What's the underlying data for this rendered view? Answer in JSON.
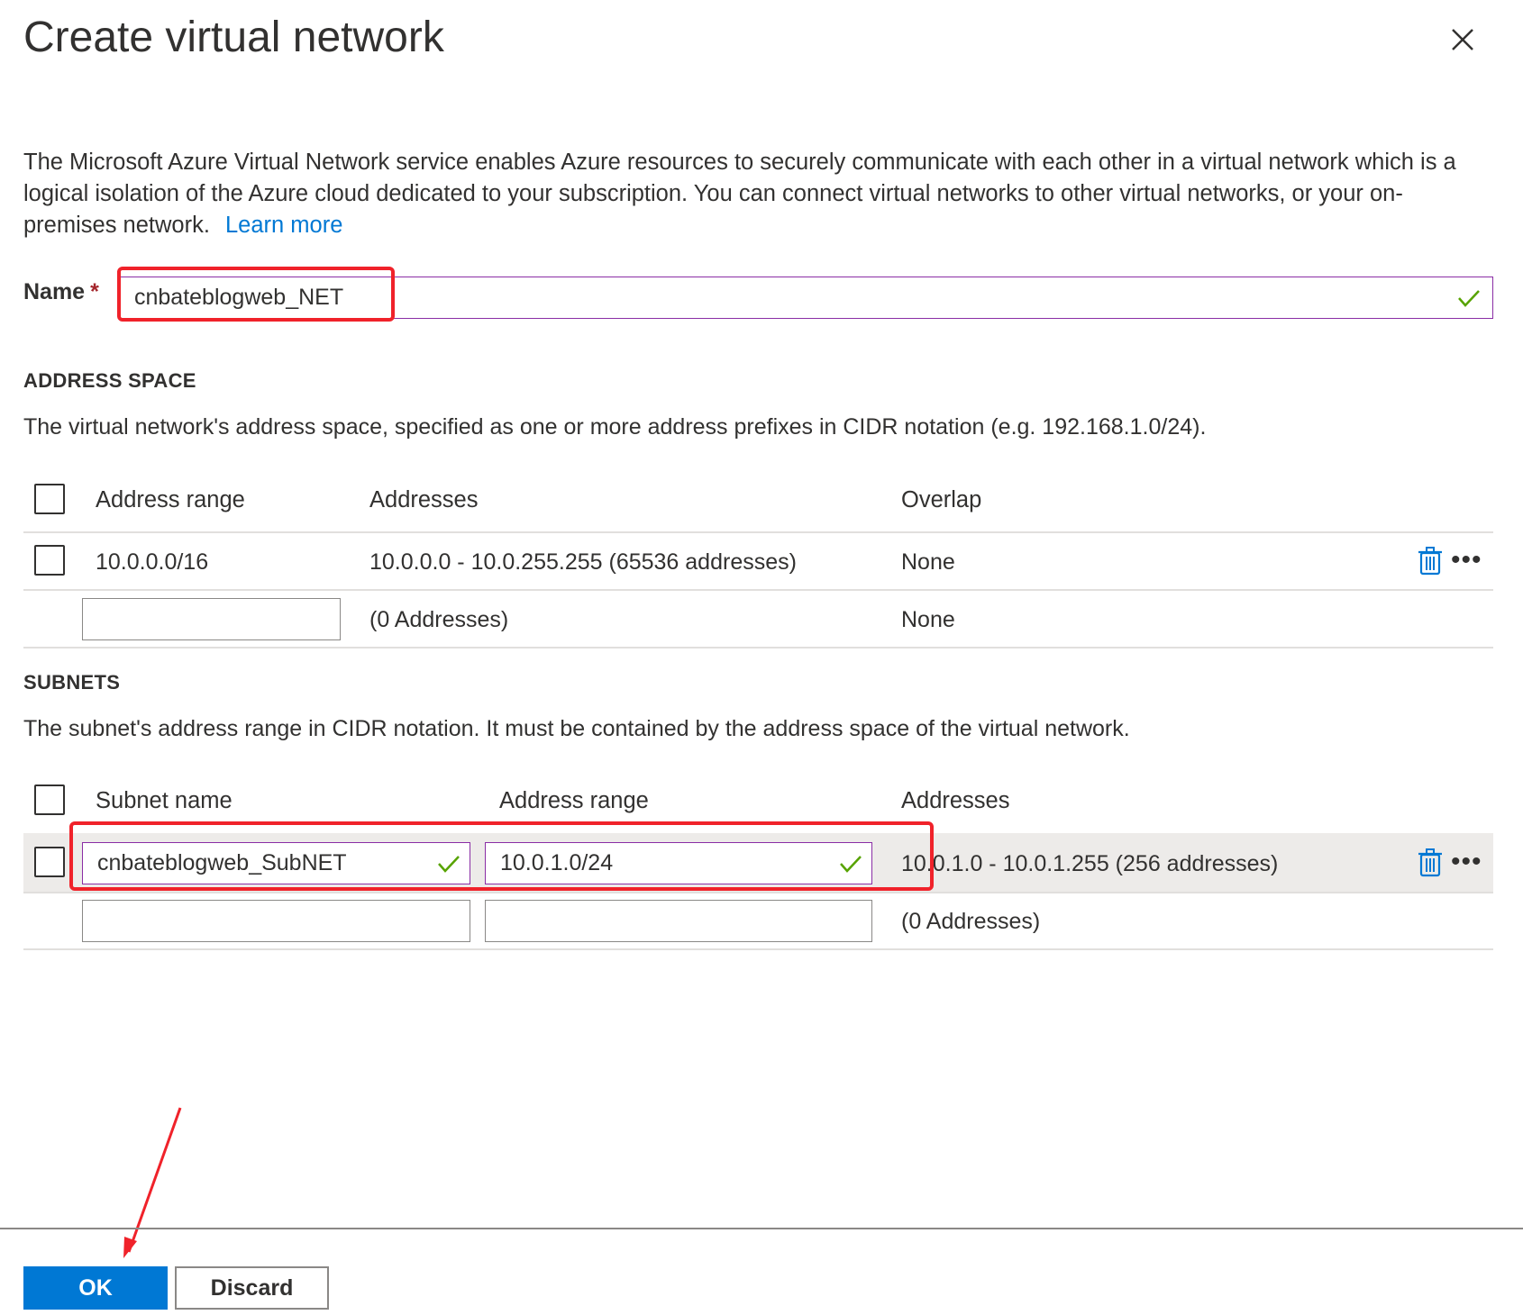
{
  "dialog": {
    "title": "Create virtual network",
    "description": "The Microsoft Azure Virtual Network service enables Azure resources to securely communicate with each other in a virtual network which is a logical isolation of the Azure cloud dedicated to your subscription. You can connect virtual networks to other virtual networks, or your on-premises network.",
    "learn_more": "Learn more",
    "close_icon": "close-icon"
  },
  "name_field": {
    "label": "Name",
    "required_marker": "*",
    "value": "cnbateblogweb_NET",
    "status": "valid"
  },
  "address_space": {
    "heading": "ADDRESS SPACE",
    "help": "The virtual network's address space, specified as one or more address prefixes in CIDR notation (e.g. 192.168.1.0/24).",
    "columns": [
      "Address range",
      "Addresses",
      "Overlap"
    ],
    "rows": [
      {
        "address_range": "10.0.0.0/16",
        "addresses": "10.0.0.0 - 10.0.255.255 (65536 addresses)",
        "overlap": "None"
      }
    ],
    "new_row": {
      "address_range_value": "",
      "addresses": "(0 Addresses)",
      "overlap": "None"
    }
  },
  "subnets": {
    "heading": "SUBNETS",
    "help": "The subnet's address range in CIDR notation. It must be contained by the address space of the virtual network.",
    "columns": [
      "Subnet name",
      "Address range",
      "Addresses"
    ],
    "rows": [
      {
        "subnet_name": "cnbateblogweb_SubNET",
        "address_range": "10.0.1.0/24",
        "addresses": "10.0.1.0 - 10.0.1.255 (256 addresses)"
      }
    ],
    "new_row": {
      "subnet_name_value": "",
      "address_range_value": "",
      "addresses": "(0 Addresses)"
    }
  },
  "footer": {
    "ok_label": "OK",
    "discard_label": "Discard"
  },
  "colors": {
    "accent": "#0078d4",
    "valid_border": "#8a2da5",
    "valid_check": "#57a300",
    "annotation_red": "#f0222a",
    "required": "#a4262c"
  }
}
